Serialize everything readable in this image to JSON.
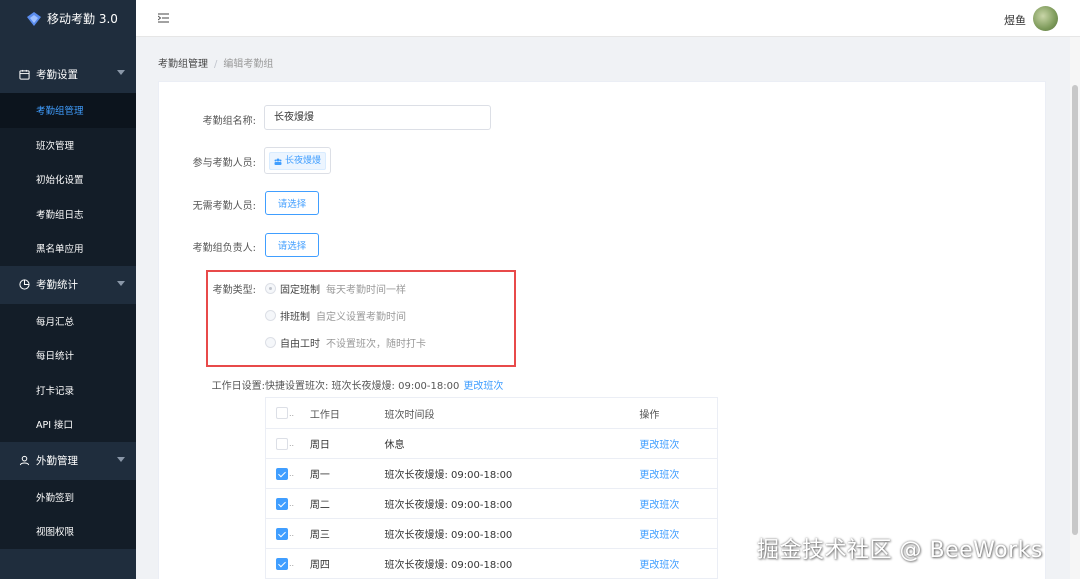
{
  "app": {
    "title": "移动考勤 3.0"
  },
  "sidebar": {
    "groups": [
      {
        "label": "考勤设置",
        "items": [
          "考勤组管理",
          "班次管理",
          "初始化设置",
          "考勤组日志",
          "黑名单应用"
        ]
      },
      {
        "label": "考勤统计",
        "items": [
          "每月汇总",
          "每日统计",
          "打卡记录",
          "API 接口"
        ]
      },
      {
        "label": "外勤管理",
        "items": [
          "外勤签到",
          "视图权限"
        ]
      }
    ]
  },
  "header": {
    "user_name": "煜鱼"
  },
  "breadcrumb": {
    "parent": "考勤组管理",
    "separator": "/",
    "current": "编辑考勤组"
  },
  "form": {
    "name_label": "考勤组名称:",
    "name_value": "长夜熳熳",
    "members_label": "参与考勤人员:",
    "member_tag": "长夜熳熳",
    "exempt_label": "无需考勤人员:",
    "exempt_button": "请选择",
    "owner_label": "考勤组负责人:",
    "owner_button": "请选择",
    "type_label": "考勤类型:",
    "types": [
      {
        "label": "固定班制",
        "desc": "每天考勤时间一样",
        "checked": true
      },
      {
        "label": "排班制",
        "desc": "自定义设置考勤时间",
        "checked": false
      },
      {
        "label": "自由工时",
        "desc": "不设置班次，随时打卡",
        "checked": false
      }
    ],
    "workday_label": "工作日设置:",
    "workday_text": "快捷设置班次: 班次长夜熳熳: 09:00-18:00",
    "workday_link": "更改班次"
  },
  "table": {
    "headers": {
      "day": "工作日",
      "time": "班次时间段",
      "op": "操作"
    },
    "rows": [
      {
        "day": "周日",
        "time": "休息",
        "op": "更改班次",
        "checked": false
      },
      {
        "day": "周一",
        "time": "班次长夜熳熳: 09:00-18:00",
        "op": "更改班次",
        "checked": true
      },
      {
        "day": "周二",
        "time": "班次长夜熳熳: 09:00-18:00",
        "op": "更改班次",
        "checked": true
      },
      {
        "day": "周三",
        "time": "班次长夜熳熳: 09:00-18:00",
        "op": "更改班次",
        "checked": true
      },
      {
        "day": "周四",
        "time": "班次长夜熳熳: 09:00-18:00",
        "op": "更改班次",
        "checked": true
      }
    ]
  },
  "watermark": "掘金技术社区 @ BeeWorks",
  "colors": {
    "sidebar_bg": "#1f2d3d",
    "accent": "#409eff",
    "highlight_border": "#e84a4a"
  }
}
